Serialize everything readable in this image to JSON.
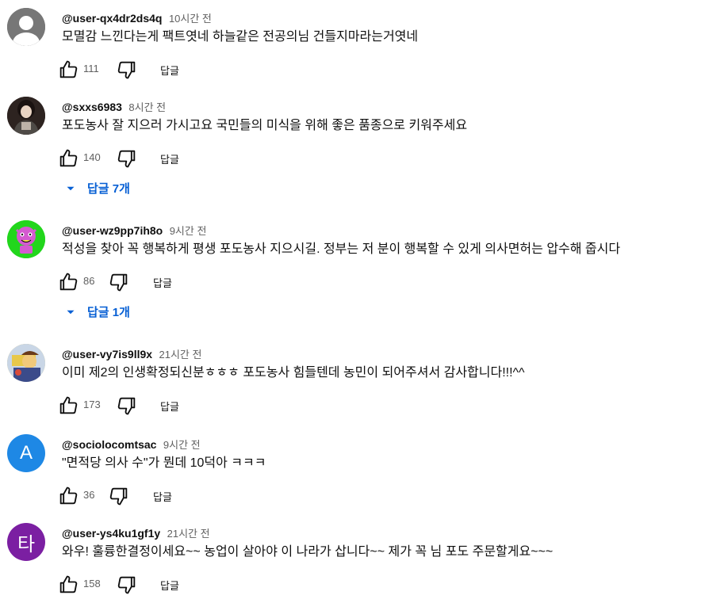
{
  "comments": [
    {
      "author": "@user-qx4dr2ds4q",
      "time": "10시간 전",
      "text": "모멸감 느낀다는게  팩트엿네  하늘같은  전공의님   건들지마라는거엿네",
      "likes": "111",
      "reply_label": "답글",
      "avatar_icon": "default-person-icon",
      "avatar_color": "#6f6f6f"
    },
    {
      "author": "@sxxs6983",
      "time": "8시간 전",
      "text": "포도농사 잘 지으러 가시고요 국민들의 미식을 위해 좋은 품종으로 키워주세요",
      "likes": "140",
      "reply_label": "답글",
      "avatar_icon": "photo-avatar",
      "avatar_color": "#3a2a26",
      "replies_label": "답글 7개"
    },
    {
      "author": "@user-wz9pp7ih8o",
      "time": "9시간 전",
      "text": "적성을 찾아 꼭 행복하게 평생 포도농사 지으시길. 정부는 저 분이 행복할 수 있게 의사면허는 압수해 줍시다",
      "likes": "86",
      "reply_label": "답글",
      "avatar_icon": "cartoon-avatar",
      "avatar_color": "#22d61c",
      "replies_label": "답글 1개"
    },
    {
      "author": "@user-vy7is9ll9x",
      "time": "21시간 전",
      "text": "이미 제2의 인생확정되신분ㅎㅎㅎ 포도농사 힘들텐데 농민이 되어주셔서 감사합니다!!!^^",
      "likes": "173",
      "reply_label": "답글",
      "avatar_icon": "cartoon-avatar",
      "avatar_color": "#e2c15a"
    },
    {
      "author": "@sociolocomtsac",
      "time": "9시간 전",
      "text": "\"면적당 의사 수\"가 뭔데 10덕아 ㅋㅋㅋ",
      "likes": "36",
      "reply_label": "답글",
      "avatar_letter": "A",
      "avatar_color": "#1e88e5"
    },
    {
      "author": "@user-ys4ku1gf1y",
      "time": "21시간 전",
      "text": "와우!  훌륭한결정이세요~~  농업이 살아야 이 나라가 삽니다~~ 제가 꼭 님 포도 주문할게요~~~",
      "likes": "158",
      "reply_label": "답글",
      "avatar_letter": "타",
      "avatar_color": "#7b1fa2"
    }
  ]
}
